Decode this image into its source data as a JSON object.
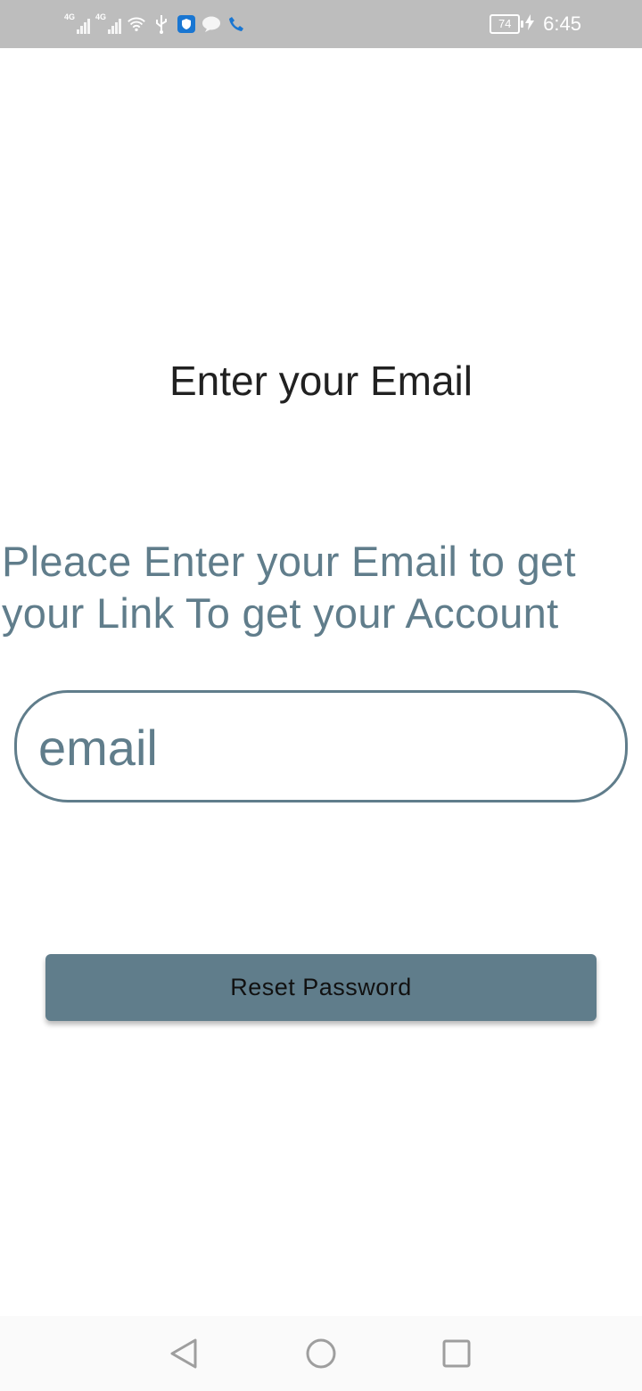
{
  "status_bar": {
    "network_1": "4G",
    "network_2": "4G",
    "battery_level": "74",
    "time": "6:45",
    "icons": [
      "signal-icon",
      "signal-icon",
      "wifi-icon",
      "usb-icon",
      "shield-app-icon",
      "chat-bubble-icon",
      "phone-icon",
      "charging-icon"
    ],
    "accent_color": "#1976d2"
  },
  "screen": {
    "title": "Enter your Email",
    "description": "Pleace Enter your Email to get your Link To get your Account",
    "email_placeholder": "email",
    "email_value": "",
    "reset_button_label": "Reset Password",
    "primary_color": "#607d8b"
  },
  "nav_bar": {
    "icons": [
      "back-icon",
      "home-icon",
      "recents-icon"
    ]
  }
}
